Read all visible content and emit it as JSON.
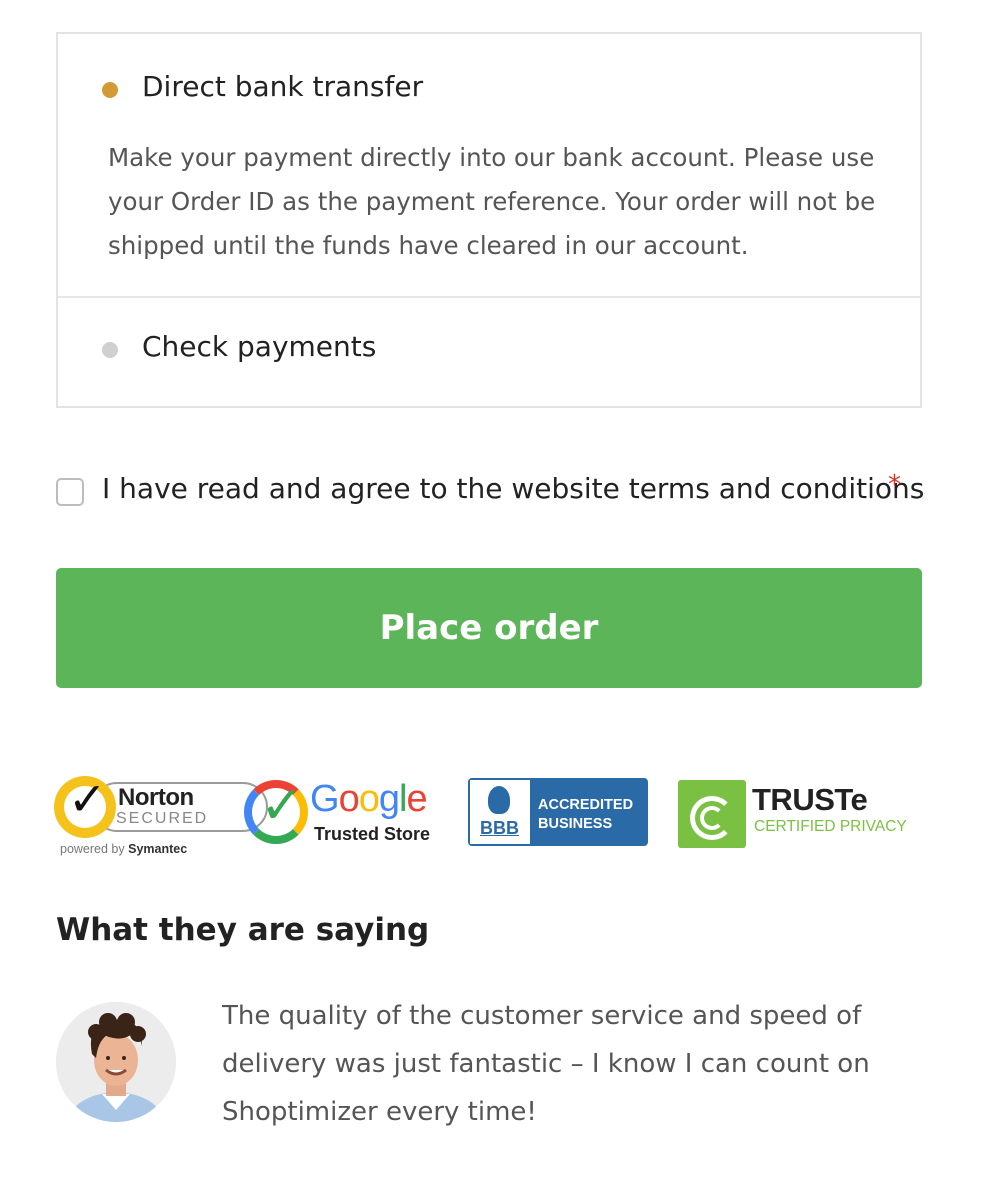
{
  "payment_methods": [
    {
      "title": "Direct bank transfer",
      "description": "Make your payment directly into our bank account. Please use your Order ID as the payment reference. Your order will not be shipped until the funds have cleared in our account.",
      "selected": true,
      "color": "#d49a35"
    },
    {
      "title": "Check payments",
      "selected": false,
      "color": "#cfcfcf"
    }
  ],
  "terms": {
    "label": "I have read and agree to the website terms and conditions",
    "required_marker": "*",
    "checked": false
  },
  "place_order": {
    "label": "Place order",
    "color": "#5db55a"
  },
  "trust_badges": {
    "norton": {
      "brand": "Norton",
      "secured": "SECURED",
      "powered_prefix": "powered by",
      "powered_brand": "Symantec"
    },
    "google": {
      "brand_letters": [
        "G",
        "o",
        "o",
        "g",
        "l",
        "e"
      ],
      "subtitle": "Trusted Store"
    },
    "bbb": {
      "logo_text": "BBB",
      "line1": "ACCREDITED",
      "line2": "BUSINESS"
    },
    "truste": {
      "brand": "TRUSTe",
      "subtitle": "CERTIFIED PRIVACY"
    }
  },
  "testimonials": {
    "heading": "What they are saying",
    "quote": "The quality of the customer service and speed of delivery was just fantastic – I know I can count on Shoptimizer every time!"
  }
}
